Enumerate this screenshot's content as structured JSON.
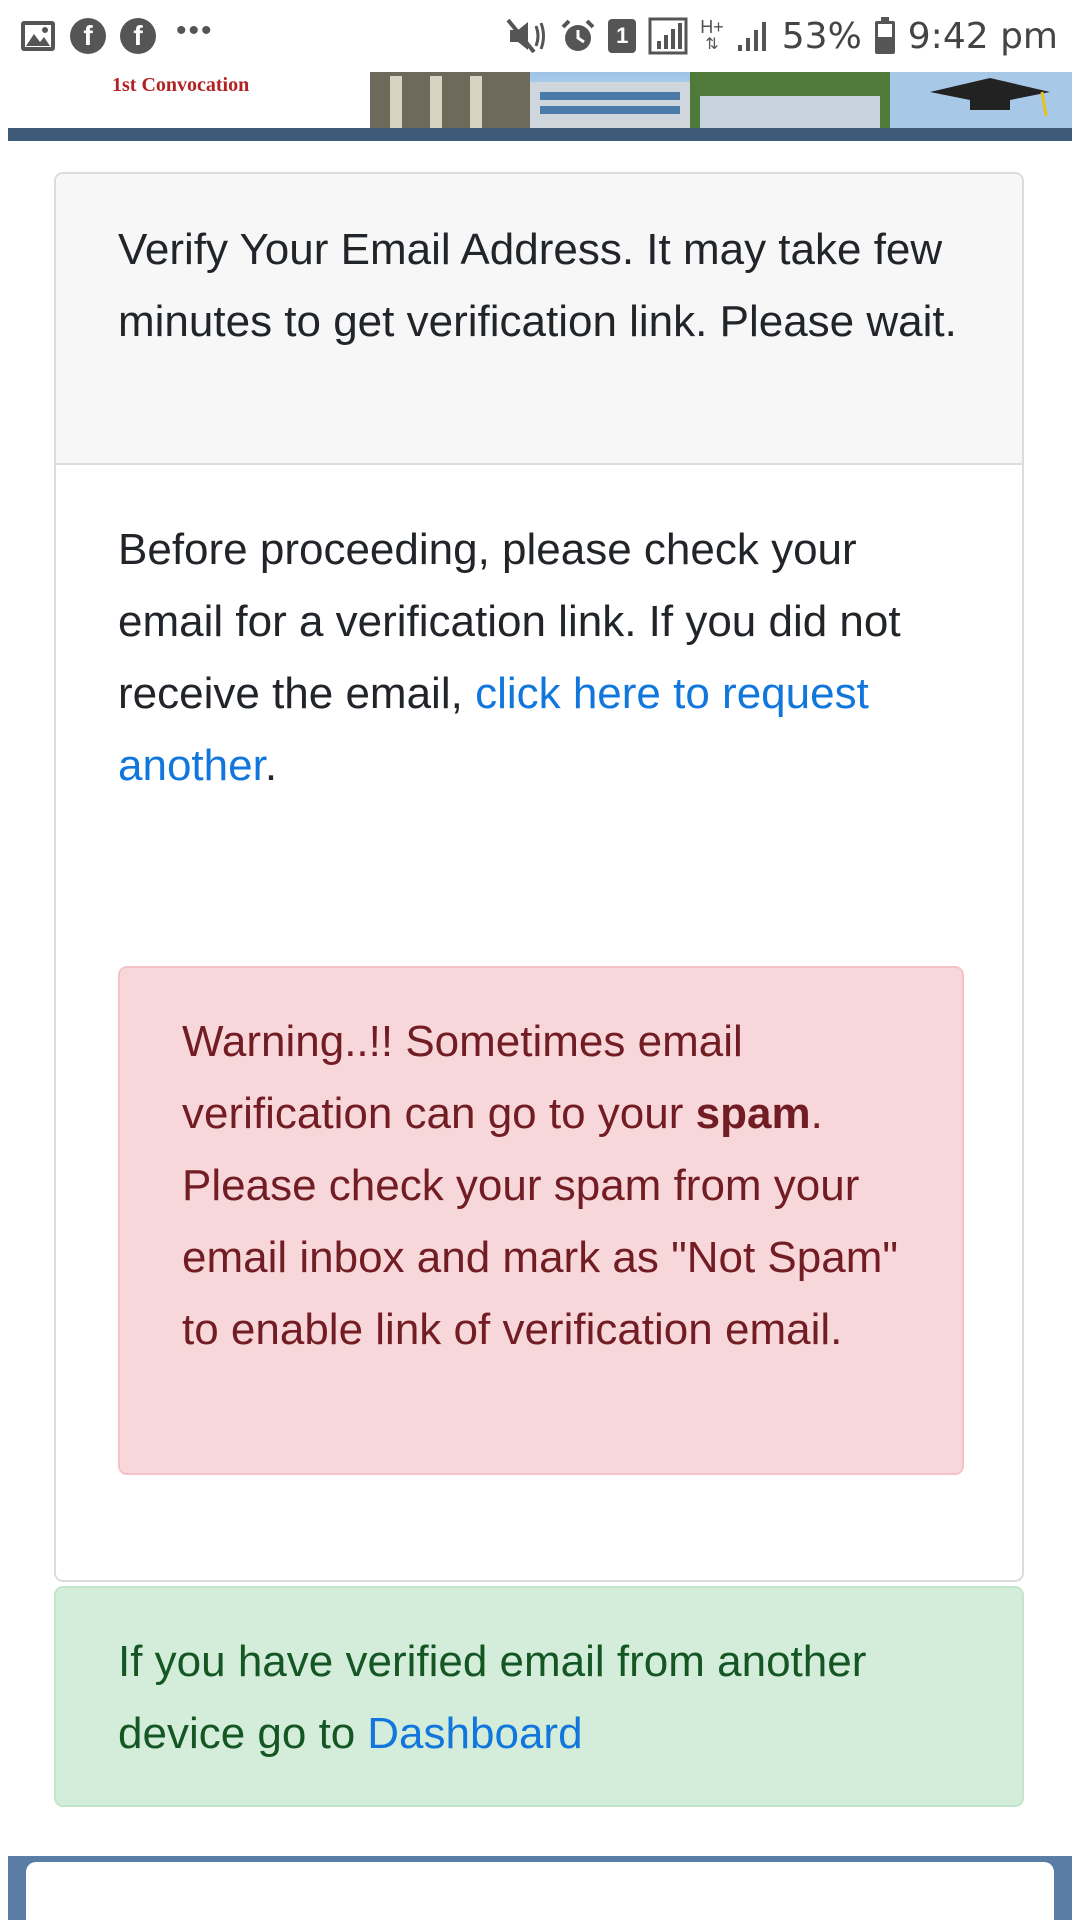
{
  "status_bar": {
    "left_icons": [
      "image-icon",
      "facebook-icon",
      "facebook-icon",
      "more-icon"
    ],
    "facebook_glyph": "f",
    "more_glyph": "•••",
    "notification_count": "1",
    "network_type": "H+",
    "battery": "53%",
    "time": "9:42 pm"
  },
  "header": {
    "logo_text": "1st Convocation"
  },
  "card": {
    "title": "Verify Your Email Address. It may take few minutes to get verification link. Please wait.",
    "body_text": "Before proceeding, please check your email for a verification link. If you did not receive the email,",
    "resend_link": "click here to request another",
    "body_end": "."
  },
  "warning": {
    "text_before": "Warning..!! Sometimes email verification can go to your",
    "strong": "spam",
    "text_after": ". Please check your spam from your email inbox and mark as \"Not Spam\" to enable link of verification email."
  },
  "success": {
    "text": "If you have verified email from another device go to",
    "link": "Dashboard"
  },
  "colors": {
    "link": "#1177dd",
    "danger_bg": "#f8d7da",
    "danger_text": "#721c24",
    "success_bg": "#d4edda",
    "success_text": "#155724",
    "banner_bar": "#3d5a78"
  }
}
